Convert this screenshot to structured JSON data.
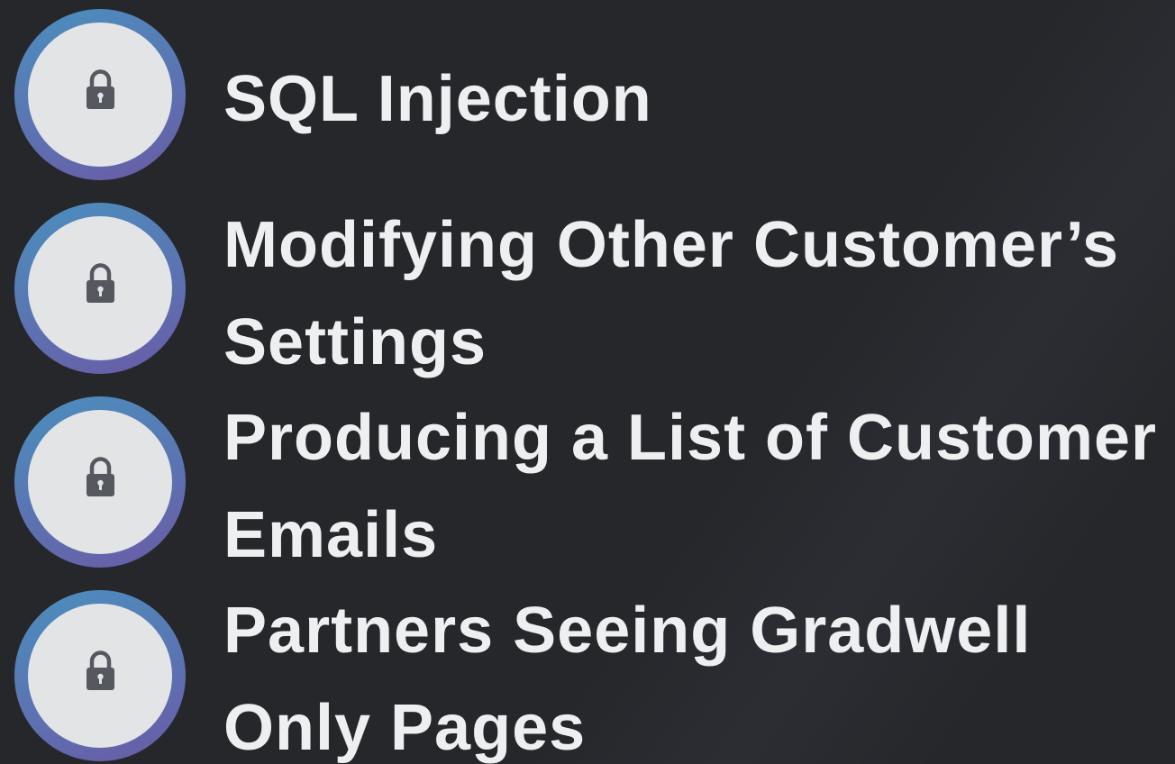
{
  "items": [
    {
      "label_lines": [
        "SQL Injection"
      ],
      "icon": "lock-icon"
    },
    {
      "label_lines": [
        "Modifying Other Customer’s",
        "Settings"
      ],
      "icon": "lock-icon"
    },
    {
      "label_lines": [
        "Producing a List of Customer",
        "Emails"
      ],
      "icon": "lock-icon"
    },
    {
      "label_lines": [
        "Partners Seeing Gradwell",
        "Only Pages"
      ],
      "icon": "lock-icon"
    }
  ],
  "colors": {
    "background": "#26272b",
    "text": "#eeeff1",
    "ring_start": "#4a8fbf",
    "ring_end": "#6a5aa6",
    "badge_face": "#e3e4e6",
    "lock": "#55585e"
  }
}
